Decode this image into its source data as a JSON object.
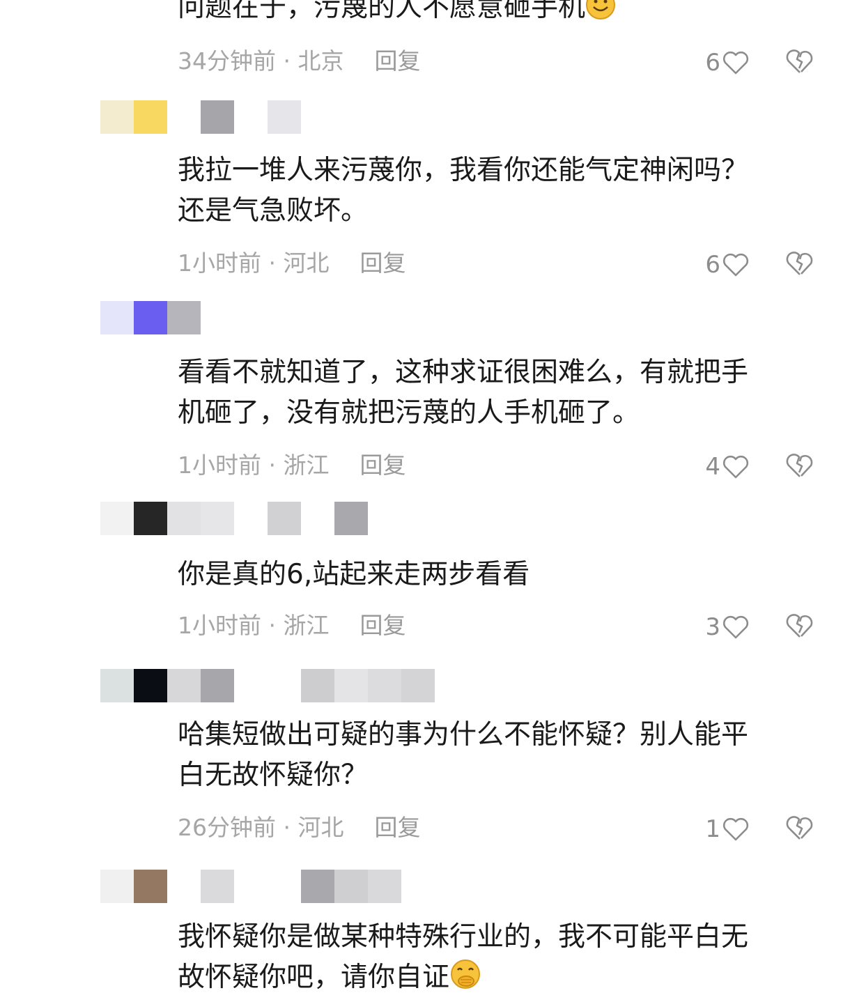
{
  "comments": [
    {
      "text": "问题在于，污蔑的人不愿意砸手机",
      "emoji": "smile-emoji",
      "time": "34分钟前",
      "sep": " · ",
      "location": "北京",
      "reply": "回复",
      "likes": "6"
    },
    {
      "avatar_colors": [
        "#f4ecce",
        "#f8d860",
        "#ffffff",
        "#a6a6aa",
        "#ffffff",
        "#e6e6ea"
      ],
      "text": "我拉一堆人来污蔑你，我看你还能气定神闲吗？\n还是气急败坏。",
      "time": "1小时前",
      "sep": " · ",
      "location": "河北",
      "reply": "回复",
      "likes": "6"
    },
    {
      "avatar_colors": [
        "#e4e4fb",
        "#6a5ef0",
        "#b5b5bb",
        "#ffffff",
        "#ffffff"
      ],
      "text": "看看不就知道了，这种求证很困难么，有就把手\n机砸了，没有就把污蔑的人手机砸了。",
      "time": "1小时前",
      "sep": " · ",
      "location": "浙江",
      "reply": "回复",
      "likes": "4"
    },
    {
      "avatar_colors": [
        "#f2f2f2",
        "#262626",
        "#e2e2e4",
        "#e6e6e8",
        "#ffffff",
        "#d1d1d4",
        "#ffffff",
        "#a9a9ad"
      ],
      "text": "你是真的6,站起来走两步看看",
      "time": "1小时前",
      "sep": " · ",
      "location": "浙江",
      "reply": "回复",
      "likes": "3"
    },
    {
      "avatar_colors": [
        "#dbe0e0",
        "#0a0d14",
        "#d7d7da",
        "#a7a7ab",
        "#ffffff",
        "#ffffff",
        "#cdcdd0",
        "#e4e4e6",
        "#dcdcde",
        "#d4d4d6"
      ],
      "text": "哈集短做出可疑的事为什么不能怀疑？别人能平\n白无故怀疑你？",
      "time": "26分钟前",
      "sep": " · ",
      "location": "河北",
      "reply": "回复",
      "likes": "1"
    },
    {
      "avatar_colors": [
        "#f0f0f0",
        "#947862",
        "#ffffff",
        "#dadadc",
        "#ffffff",
        "#ffffff",
        "#a9a9ad",
        "#cfcfd2",
        "#d9d9db"
      ],
      "text": "我怀疑你是做某种特殊行业的，我不可能平白无\n故怀疑你吧，请你自证",
      "emoji": "face-with-hand-over-mouth-emoji"
    }
  ],
  "colors": {
    "text": "#1a1a1a",
    "meta": "#a6a6a6",
    "icon": "#8c8c8c",
    "emoji": "#f7c33a"
  }
}
